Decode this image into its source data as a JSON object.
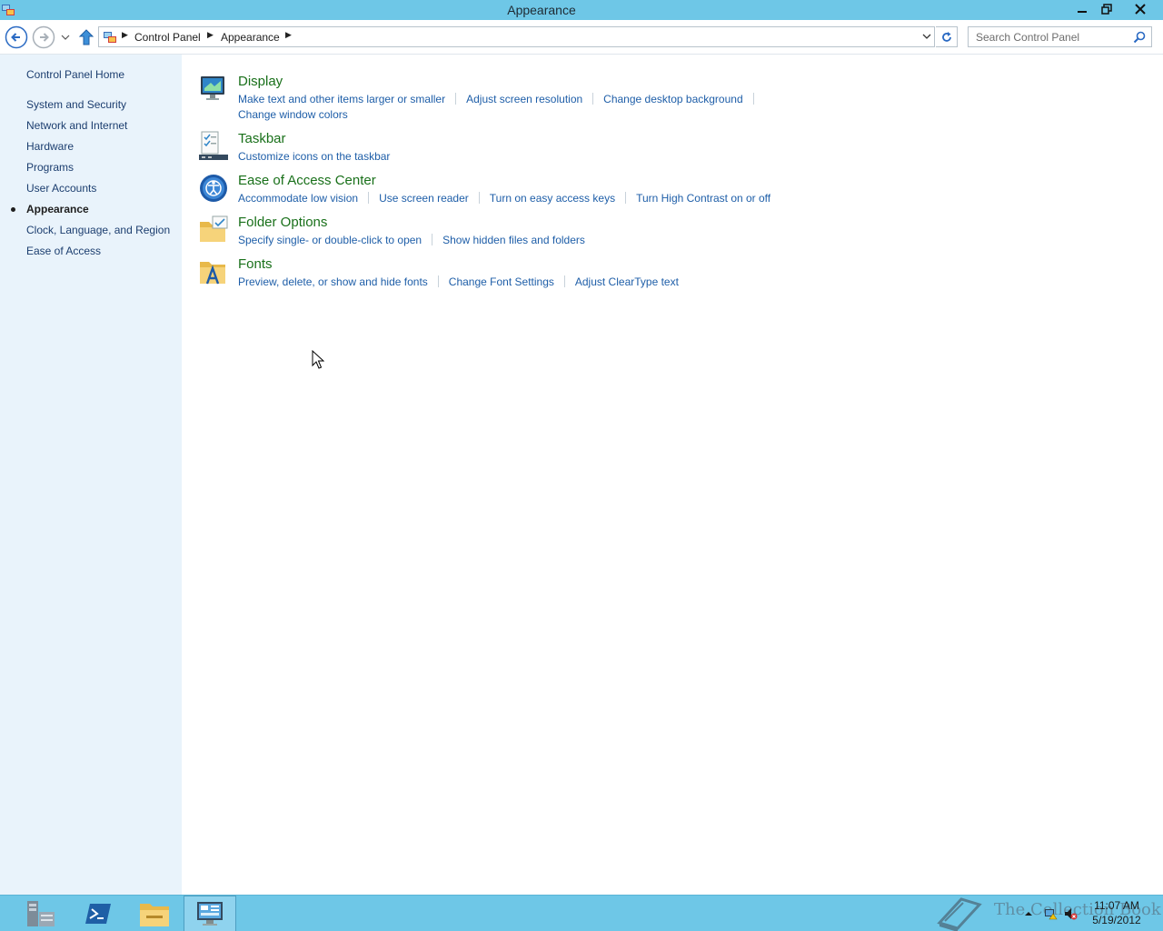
{
  "window": {
    "title": "Appearance"
  },
  "address_bar": {
    "breadcrumbs": [
      "Control Panel",
      "Appearance"
    ]
  },
  "search": {
    "placeholder": "Search Control Panel"
  },
  "sidebar": {
    "home": "Control Panel Home",
    "items": [
      {
        "label": "System and Security",
        "active": false
      },
      {
        "label": "Network and Internet",
        "active": false
      },
      {
        "label": "Hardware",
        "active": false
      },
      {
        "label": "Programs",
        "active": false
      },
      {
        "label": "User Accounts",
        "active": false
      },
      {
        "label": "Appearance",
        "active": true
      },
      {
        "label": "Clock, Language, and Region",
        "active": false
      },
      {
        "label": "Ease of Access",
        "active": false
      }
    ]
  },
  "categories": [
    {
      "title": "Display",
      "icon": "display-icon",
      "tasks": [
        "Make text and other items larger or smaller",
        "Adjust screen resolution",
        "Change desktop background",
        "Change window colors"
      ]
    },
    {
      "title": "Taskbar",
      "icon": "taskbar-icon",
      "tasks": [
        "Customize icons on the taskbar"
      ]
    },
    {
      "title": "Ease of Access Center",
      "icon": "ease-of-access-icon",
      "tasks": [
        "Accommodate low vision",
        "Use screen reader",
        "Turn on easy access keys",
        "Turn High Contrast on or off"
      ]
    },
    {
      "title": "Folder Options",
      "icon": "folder-options-icon",
      "tasks": [
        "Specify single- or double-click to open",
        "Show hidden files and folders"
      ]
    },
    {
      "title": "Fonts",
      "icon": "fonts-icon",
      "tasks": [
        "Preview, delete, or show and hide fonts",
        "Change Font Settings",
        "Adjust ClearType text"
      ]
    }
  ],
  "taskbar": {
    "apps": [
      "server-manager-icon",
      "powershell-icon",
      "file-explorer-icon",
      "control-panel-icon"
    ],
    "active_app": "control-panel-icon",
    "watermark": "The Collection Book",
    "clock": {
      "time": "11:07 AM",
      "date": "5/19/2012"
    }
  },
  "colors": {
    "titlebar": "#6ec7e7",
    "sidebar_bg": "#e9f3fb",
    "category_title": "#19701a",
    "task_link": "#1e5ea8",
    "sidebar_link": "#1c3e6f"
  }
}
